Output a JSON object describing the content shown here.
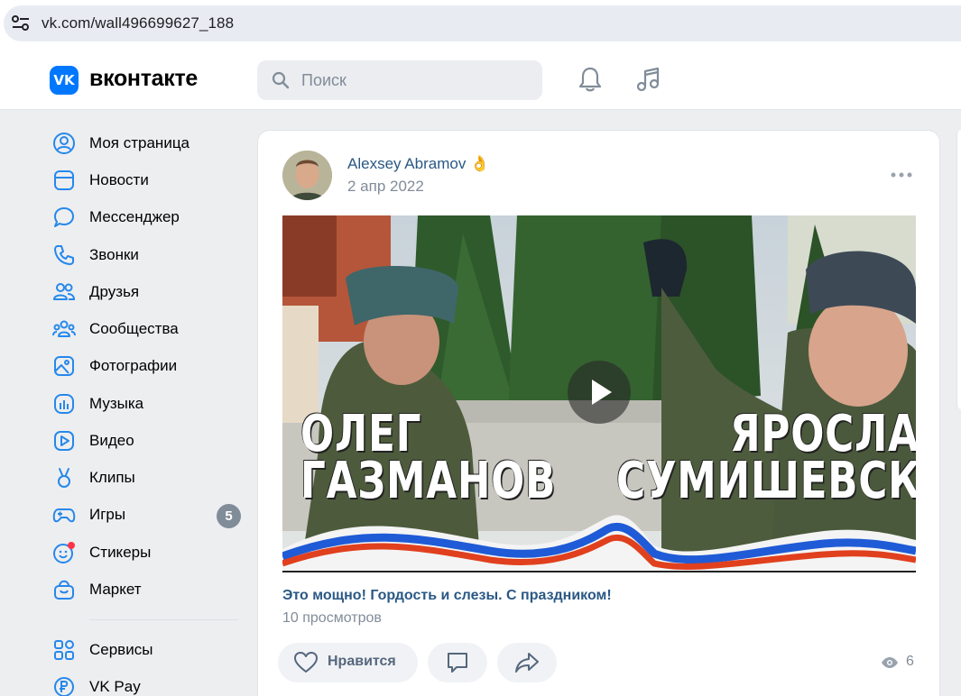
{
  "browser": {
    "url": "vk.com/wall496699627_188"
  },
  "header": {
    "brand": "вконтакте",
    "logo_text": "VK",
    "search_placeholder": "Поиск"
  },
  "sidebar": {
    "items": [
      {
        "label": "Моя страница",
        "icon": "user-circle-icon"
      },
      {
        "label": "Новости",
        "icon": "newsfeed-icon"
      },
      {
        "label": "Мессенджер",
        "icon": "message-icon"
      },
      {
        "label": "Звонки",
        "icon": "phone-icon"
      },
      {
        "label": "Друзья",
        "icon": "users-icon"
      },
      {
        "label": "Сообщества",
        "icon": "groups-icon"
      },
      {
        "label": "Фотографии",
        "icon": "photo-icon"
      },
      {
        "label": "Музыка",
        "icon": "music-icon"
      },
      {
        "label": "Видео",
        "icon": "video-icon"
      },
      {
        "label": "Клипы",
        "icon": "clips-icon"
      },
      {
        "label": "Игры",
        "icon": "gamepad-icon",
        "badge": "5"
      },
      {
        "label": "Стикеры",
        "icon": "sticker-icon"
      },
      {
        "label": "Маркет",
        "icon": "market-icon"
      },
      {
        "label": "Сервисы",
        "icon": "services-icon"
      },
      {
        "label": "VK Pay",
        "icon": "vkpay-icon"
      }
    ]
  },
  "post": {
    "author": "Alexsey Abramov",
    "author_emoji": "👌",
    "date": "2 апр 2022",
    "video": {
      "title": "Это мощно! Гордость и слезы. С праздником!",
      "views": "10 просмотров",
      "overlay_left_line1": "ОЛЕГ",
      "overlay_left_line2": "ГАЗМАНОВ",
      "overlay_right_line1": "ЯРОСЛАВ",
      "overlay_right_line2": "СУМИШЕВСКИЙ"
    },
    "actions": {
      "like_label": "Нравится",
      "views_count": "6"
    }
  },
  "colors": {
    "accent": "#0077ff",
    "link": "#2a5885",
    "secondary_text": "#818c99",
    "background": "#edeef0"
  }
}
